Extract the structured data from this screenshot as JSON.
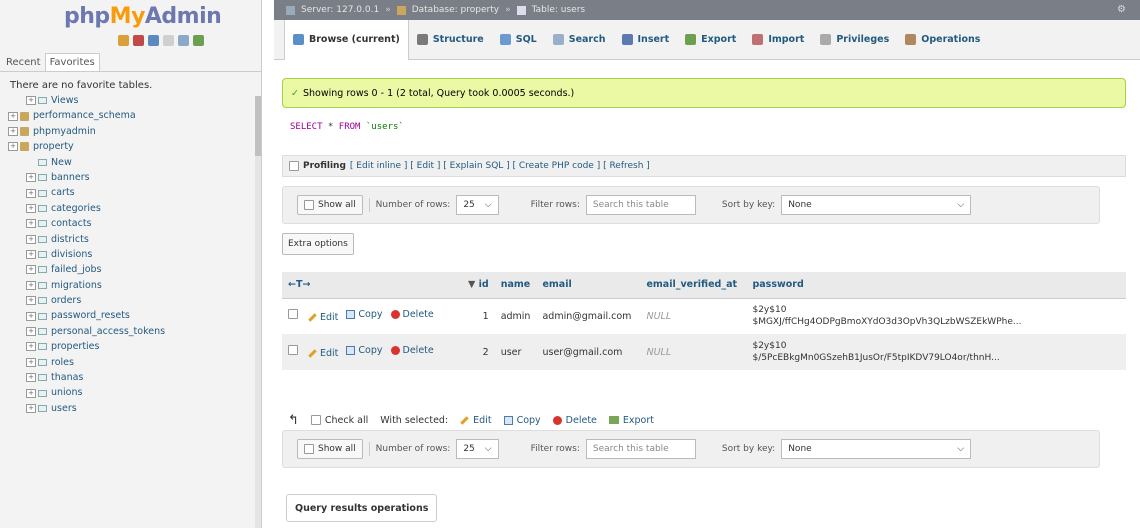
{
  "logo": {
    "php": "php",
    "my": "My",
    "admin": "Admin"
  },
  "left_tabs": {
    "recent": "Recent",
    "favorites": "Favorites"
  },
  "no_favorites": "There are no favorite tables.",
  "tree": [
    {
      "label": "Views",
      "level": 2,
      "type": "folder"
    },
    {
      "label": "performance_schema",
      "level": 1,
      "type": "db"
    },
    {
      "label": "phpmyadmin",
      "level": 1,
      "type": "db"
    },
    {
      "label": "property",
      "level": 1,
      "type": "db"
    },
    {
      "label": "New",
      "level": 2,
      "type": "new"
    },
    {
      "label": "banners",
      "level": 2,
      "type": "table"
    },
    {
      "label": "carts",
      "level": 2,
      "type": "table"
    },
    {
      "label": "categories",
      "level": 2,
      "type": "table"
    },
    {
      "label": "contacts",
      "level": 2,
      "type": "table"
    },
    {
      "label": "districts",
      "level": 2,
      "type": "table"
    },
    {
      "label": "divisions",
      "level": 2,
      "type": "table"
    },
    {
      "label": "failed_jobs",
      "level": 2,
      "type": "table"
    },
    {
      "label": "migrations",
      "level": 2,
      "type": "table"
    },
    {
      "label": "orders",
      "level": 2,
      "type": "table"
    },
    {
      "label": "password_resets",
      "level": 2,
      "type": "table"
    },
    {
      "label": "personal_access_tokens",
      "level": 2,
      "type": "table"
    },
    {
      "label": "properties",
      "level": 2,
      "type": "table"
    },
    {
      "label": "roles",
      "level": 2,
      "type": "table"
    },
    {
      "label": "thanas",
      "level": 2,
      "type": "table"
    },
    {
      "label": "unions",
      "level": 2,
      "type": "table"
    },
    {
      "label": "users",
      "level": 2,
      "type": "table"
    }
  ],
  "breadcrumb": {
    "server": "Server: 127.0.0.1",
    "database": "Database: property",
    "table": "Table: users"
  },
  "menu": [
    {
      "label": "Browse (current)",
      "icon": "browse-icon",
      "color": "#5b8fc7"
    },
    {
      "label": "Structure",
      "icon": "structure-icon",
      "color": "#7a7a7a"
    },
    {
      "label": "SQL",
      "icon": "sql-icon",
      "color": "#6a9ad0"
    },
    {
      "label": "Search",
      "icon": "search-icon",
      "color": "#9ab0c8"
    },
    {
      "label": "Insert",
      "icon": "insert-icon",
      "color": "#5a7ab0"
    },
    {
      "label": "Export",
      "icon": "export-icon",
      "color": "#6aa050"
    },
    {
      "label": "Import",
      "icon": "import-icon",
      "color": "#c07070"
    },
    {
      "label": "Privileges",
      "icon": "privileges-icon",
      "color": "#aaaaaa"
    },
    {
      "label": "Operations",
      "icon": "operations-icon",
      "color": "#b08860"
    }
  ],
  "success_message": "Showing rows 0 - 1 (2 total, Query took 0.0005 seconds.)",
  "sql": {
    "select": "SELECT",
    "star": " * ",
    "from": "FROM",
    "table": "`users`"
  },
  "profiling": {
    "label": "Profiling",
    "links": "[ Edit inline ] [ Edit ] [ Explain SQL ] [ Create PHP code ] [ Refresh ]"
  },
  "nav": {
    "show_all": "Show all",
    "number_of_rows": "Number of rows:",
    "rows_value": "25",
    "filter_rows": "Filter rows:",
    "filter_placeholder": "Search this table",
    "sort_by_key": "Sort by key:",
    "sort_value": "None"
  },
  "extra_options": "Extra options",
  "table": {
    "headers": {
      "arrows": "←T→",
      "id": "id",
      "name": "name",
      "email": "email",
      "email_verified_at": "email_verified_at",
      "password": "password"
    },
    "actions": {
      "edit": "Edit",
      "copy": "Copy",
      "delete": "Delete"
    },
    "rows": [
      {
        "id": "1",
        "name": "admin",
        "email": "admin@gmail.com",
        "verified": "NULL",
        "pw1": "$2y$10",
        "pw2": "$MGXJ/ffCHg4ODPgBmoXYdO3d3OpVh3QLzbWSZEkWPhe..."
      },
      {
        "id": "2",
        "name": "user",
        "email": "user@gmail.com",
        "verified": "NULL",
        "pw1": "$2y$10",
        "pw2": "$/5PcEBkgMn0GSzehB1JusOr/F5tpIKDV79LO4or/thnH..."
      }
    ]
  },
  "bulk": {
    "check_all": "Check all",
    "with_selected": "With selected:",
    "edit": "Edit",
    "copy": "Copy",
    "delete": "Delete",
    "export": "Export"
  },
  "query_results_operations": "Query results operations"
}
